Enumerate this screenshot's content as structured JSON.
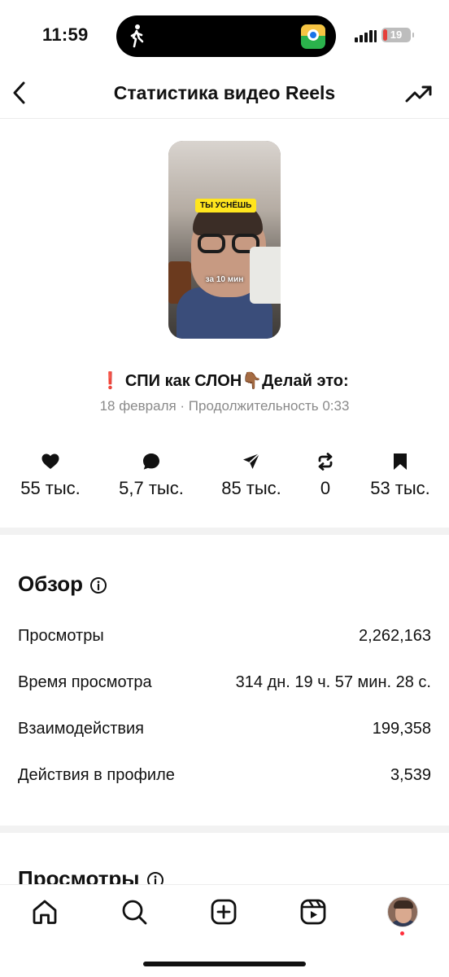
{
  "status_bar": {
    "time": "11:59",
    "battery": "19"
  },
  "header": {
    "title": "Статистика видео Reels"
  },
  "thumbnail": {
    "overlay_top": "ТЫ УСНЁШЬ",
    "overlay_bottom": "за 10 мин"
  },
  "post": {
    "caption_mark": "❗",
    "caption_text": "СПИ как СЛОН",
    "caption_emoji": "👇🏾",
    "caption_text2": "Делай это:",
    "meta": "18 февраля · Продолжительность 0:33"
  },
  "stats": [
    {
      "icon": "heart-icon",
      "value": "55 тыс."
    },
    {
      "icon": "comment-icon",
      "value": "5,7 тыс."
    },
    {
      "icon": "send-icon",
      "value": "85 тыс."
    },
    {
      "icon": "repost-icon",
      "value": "0"
    },
    {
      "icon": "bookmark-icon",
      "value": "53 тыс."
    }
  ],
  "overview": {
    "title": "Обзор",
    "rows": [
      {
        "label": "Просмотры",
        "value": "2,262,163"
      },
      {
        "label": "Время просмотра",
        "value": "314 дн. 19 ч. 57 мин. 28 с."
      },
      {
        "label": "Взаимодействия",
        "value": "199,358"
      },
      {
        "label": "Действия в профиле",
        "value": "3,539"
      }
    ]
  },
  "views_section": {
    "title": "Просмотры"
  },
  "bottom_nav": [
    "home-icon",
    "search-icon",
    "create-icon",
    "reels-icon",
    "profile-avatar"
  ]
}
